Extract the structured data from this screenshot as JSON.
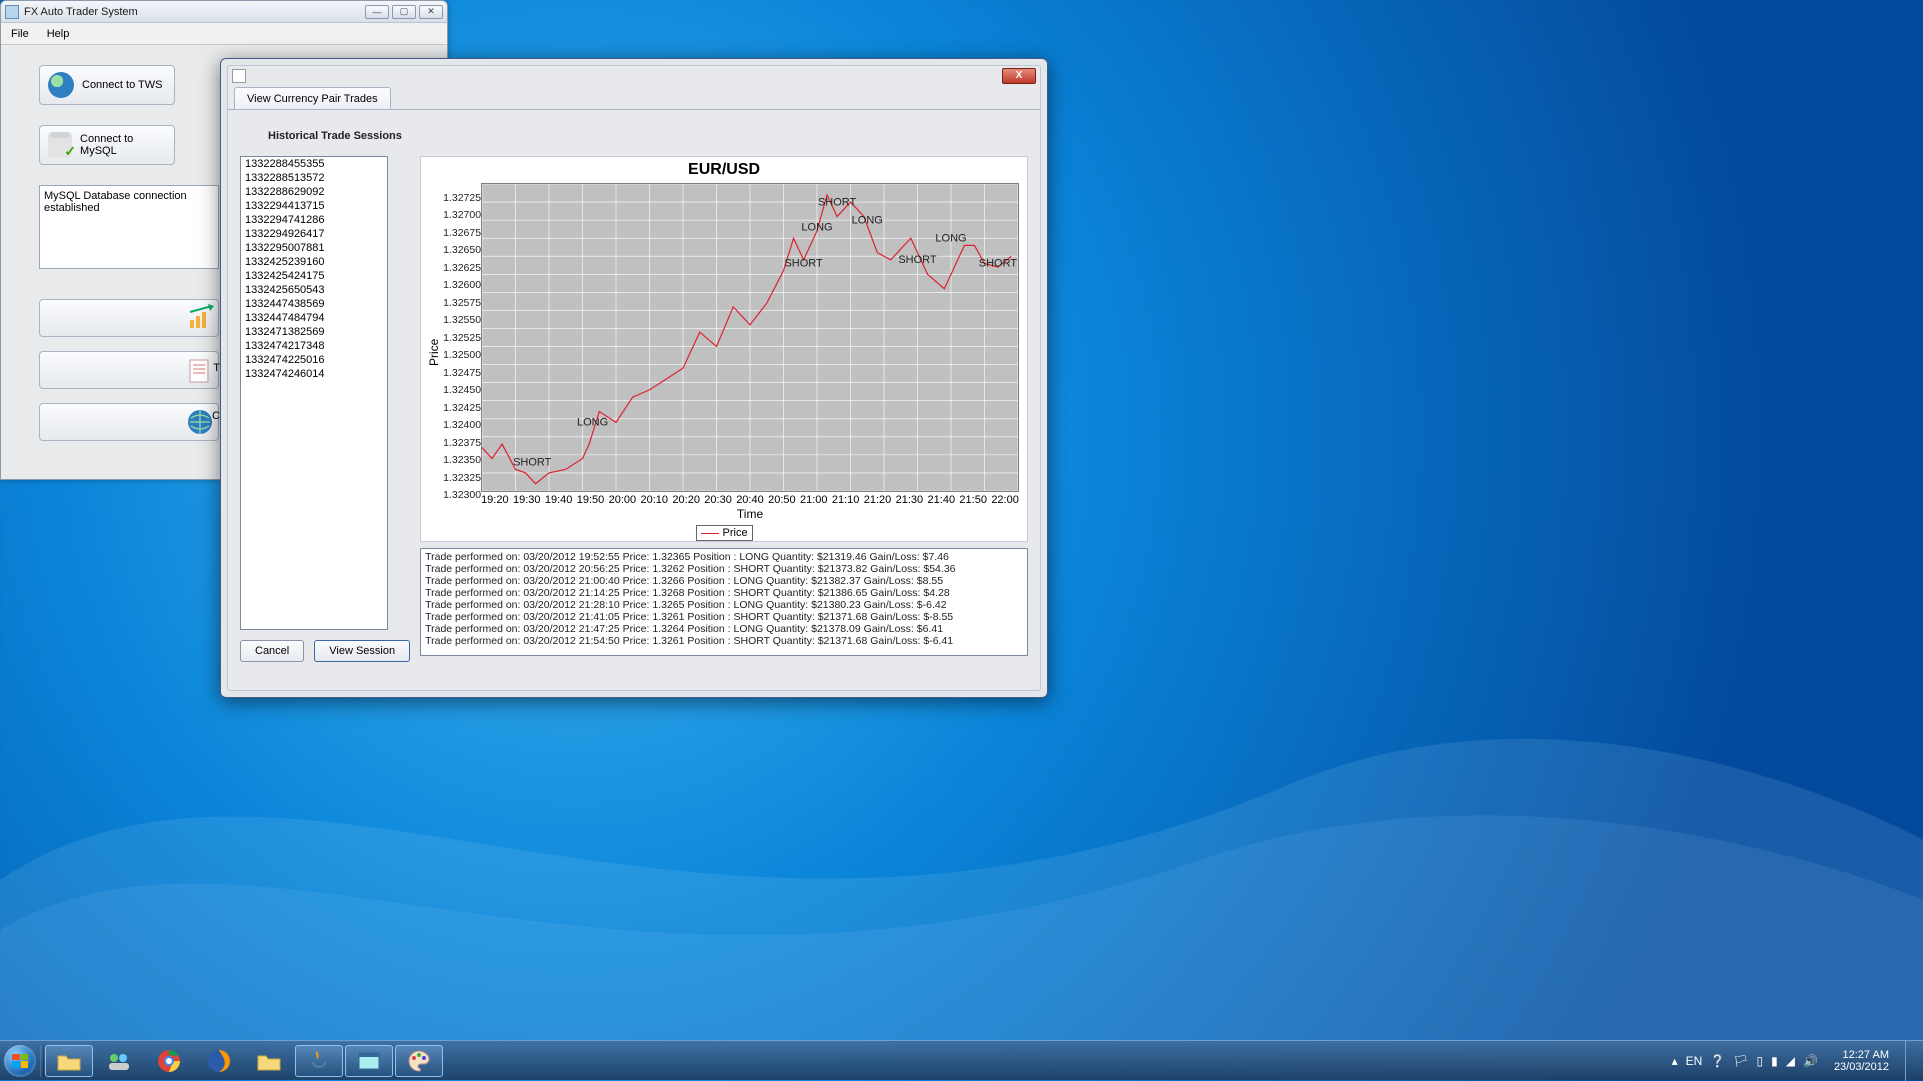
{
  "desktop": {
    "os_hint": "Windows 7"
  },
  "main_window": {
    "title": "FX Auto Trader System",
    "menu": {
      "file": "File",
      "help": "Help"
    },
    "connect_tws_label": "Connect to TWS",
    "connect_mysql_label": "Connect to MySQL",
    "status_text": "MySQL Database connection established",
    "stub_button_3_hint": "T",
    "stub_button_4_hint": "C"
  },
  "dialog": {
    "tab_label": "View Currency Pair Trades",
    "section_title": "Historical Trade Sessions",
    "sessions": [
      "1332288455355",
      "1332288513572",
      "1332288629092",
      "1332294413715",
      "1332294741286",
      "1332294926417",
      "1332295007881",
      "1332425239160",
      "1332425424175",
      "1332425650543",
      "1332447438569",
      "1332447484794",
      "1332471382569",
      "1332474217348",
      "1332474225016",
      "1332474246014"
    ],
    "cancel_label": "Cancel",
    "view_session_label": "View Session",
    "trade_log": [
      "Trade performed on: 03/20/2012 19:52:55 Price: 1.32365 Position : LONG Quantity: $21319.46 Gain/Loss: $7.46",
      "Trade performed on: 03/20/2012 20:56:25 Price: 1.3262 Position : SHORT Quantity: $21373.82 Gain/Loss: $54.36",
      "Trade performed on: 03/20/2012 21:00:40 Price: 1.3266 Position : LONG Quantity: $21382.37 Gain/Loss: $8.55",
      "Trade performed on: 03/20/2012 21:14:25 Price: 1.3268 Position : SHORT Quantity: $21386.65 Gain/Loss: $4.28",
      "Trade performed on: 03/20/2012 21:28:10 Price: 1.3265 Position : LONG Quantity: $21380.23 Gain/Loss: $-6.42",
      "Trade performed on: 03/20/2012 21:41:05 Price: 1.3261 Position : SHORT Quantity: $21371.68 Gain/Loss: $-8.55",
      "Trade performed on: 03/20/2012 21:47:25 Price: 1.3264 Position : LONG Quantity: $21378.09 Gain/Loss: $6.41",
      "Trade performed on: 03/20/2012 21:54:50 Price: 1.3261 Position : SHORT Quantity: $21371.68 Gain/Loss: $-6.41"
    ]
  },
  "chart_data": {
    "type": "line",
    "title": "EUR/USD",
    "xlabel": "Time",
    "ylabel": "Price",
    "legend": [
      "Price"
    ],
    "ylim": [
      1.323,
      1.32725
    ],
    "yticks": [
      1.32725,
      1.327,
      1.32675,
      1.3265,
      1.32625,
      1.326,
      1.32575,
      1.3255,
      1.32525,
      1.325,
      1.32475,
      1.3245,
      1.32425,
      1.324,
      1.32375,
      1.3235,
      1.32325,
      1.323
    ],
    "xticks": [
      "19:20",
      "19:30",
      "19:40",
      "19:50",
      "20:00",
      "20:10",
      "20:20",
      "20:30",
      "20:40",
      "20:50",
      "21:00",
      "21:10",
      "21:20",
      "21:30",
      "21:40",
      "21:50",
      "22:00"
    ],
    "series": [
      {
        "name": "Price",
        "x": [
          "19:17",
          "19:20",
          "19:23",
          "19:26",
          "19:30",
          "19:33",
          "19:36",
          "19:40",
          "19:45",
          "19:50",
          "19:52",
          "19:55",
          "20:00",
          "20:05",
          "20:10",
          "20:15",
          "20:20",
          "20:25",
          "20:30",
          "20:35",
          "20:40",
          "20:45",
          "20:50",
          "20:53",
          "20:56",
          "21:00",
          "21:03",
          "21:06",
          "21:10",
          "21:14",
          "21:18",
          "21:22",
          "21:28",
          "21:33",
          "21:38",
          "21:41",
          "21:44",
          "21:47",
          "21:50",
          "21:54",
          "21:58"
        ],
        "y": [
          1.3235,
          1.3236,
          1.32345,
          1.32365,
          1.3233,
          1.32325,
          1.3231,
          1.32325,
          1.3233,
          1.32345,
          1.32365,
          1.3241,
          1.32395,
          1.3243,
          1.3244,
          1.32455,
          1.3247,
          1.3252,
          1.325,
          1.32555,
          1.3253,
          1.3256,
          1.32605,
          1.3265,
          1.3262,
          1.3266,
          1.3271,
          1.3268,
          1.327,
          1.3268,
          1.3263,
          1.3262,
          1.3265,
          1.326,
          1.3258,
          1.3261,
          1.3264,
          1.3264,
          1.32615,
          1.3261,
          1.32625
        ]
      }
    ],
    "annotations": [
      {
        "x": "19:35",
        "y": 1.3233,
        "text": "SHORT"
      },
      {
        "x": "19:53",
        "y": 1.32385,
        "text": "LONG"
      },
      {
        "x": "20:56",
        "y": 1.32605,
        "text": "SHORT"
      },
      {
        "x": "21:00",
        "y": 1.32655,
        "text": "LONG"
      },
      {
        "x": "21:06",
        "y": 1.3269,
        "text": "SHORT"
      },
      {
        "x": "21:15",
        "y": 1.32665,
        "text": "LONG"
      },
      {
        "x": "21:30",
        "y": 1.3261,
        "text": "SHORT"
      },
      {
        "x": "21:40",
        "y": 1.3264,
        "text": "LONG"
      },
      {
        "x": "21:54",
        "y": 1.32605,
        "text": "SHORT"
      }
    ]
  },
  "taskbar": {
    "lang": "EN",
    "clock_time": "12:27 AM",
    "clock_date": "23/03/2012"
  }
}
